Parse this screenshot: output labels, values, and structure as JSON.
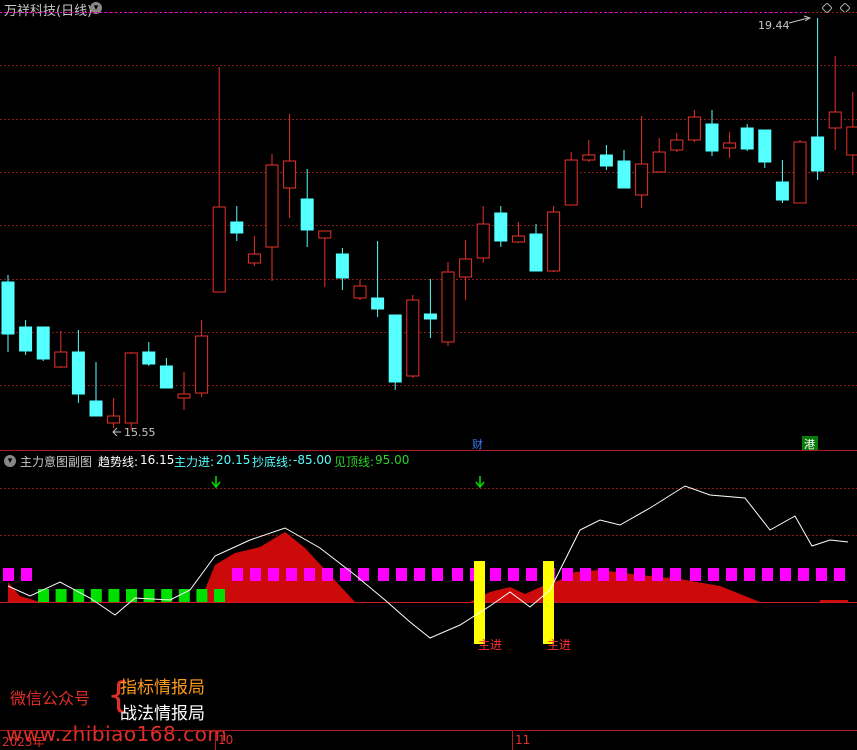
{
  "title": "万祥科技(日线)",
  "main_chart": {
    "high_label": "19.44",
    "low_label": "15.55",
    "markers": [
      {
        "label": "财",
        "color": "#3a7bff"
      },
      {
        "label": "港",
        "color": "#ffffff"
      }
    ],
    "colors": {
      "up": "#e8322a",
      "down": "#54ffff",
      "grid": "#8b1a1a"
    },
    "candles": [
      {
        "o": [
          282,
          334
        ],
        "l": [
          275,
          352
        ],
        "c": "#54ffff"
      },
      {
        "o": [
          327,
          351
        ],
        "l": [
          320,
          355
        ],
        "c": "#54ffff"
      },
      {
        "o": [
          327,
          359
        ],
        "l": [
          327,
          361
        ],
        "c": "#54ffff"
      },
      {
        "o": [
          352,
          367
        ],
        "l": [
          331,
          368
        ],
        "c": "#e8322a"
      },
      {
        "o": [
          352,
          394
        ],
        "l": [
          330,
          403
        ],
        "c": "#54ffff"
      },
      {
        "o": [
          401,
          416
        ],
        "l": [
          362,
          416
        ],
        "c": "#54ffff"
      },
      {
        "o": [
          416,
          423
        ],
        "l": [
          398,
          428
        ],
        "c": "#e8322a"
      },
      {
        "o": [
          353,
          423
        ],
        "l": [
          352,
          430
        ],
        "c": "#e8322a"
      },
      {
        "o": [
          352,
          364
        ],
        "l": [
          342,
          366
        ],
        "c": "#54ffff"
      },
      {
        "o": [
          366,
          388
        ],
        "l": [
          358,
          388
        ],
        "c": "#54ffff"
      },
      {
        "o": [
          394,
          398
        ],
        "l": [
          372,
          410
        ],
        "c": "#e8322a"
      },
      {
        "o": [
          336,
          393
        ],
        "l": [
          320,
          397
        ],
        "c": "#e8322a"
      },
      {
        "o": [
          207,
          292
        ],
        "l": [
          67,
          292
        ],
        "c": "#e8322a"
      },
      {
        "o": [
          222,
          233
        ],
        "l": [
          206,
          241
        ],
        "c": "#54ffff"
      },
      {
        "o": [
          254,
          263
        ],
        "l": [
          236,
          266
        ],
        "c": "#e8322a"
      },
      {
        "o": [
          165,
          247
        ],
        "l": [
          154,
          281
        ],
        "c": "#e8322a"
      },
      {
        "o": [
          161,
          188
        ],
        "l": [
          114,
          218
        ],
        "c": "#e8322a"
      },
      {
        "o": [
          199,
          230
        ],
        "l": [
          169,
          247
        ],
        "c": "#54ffff"
      },
      {
        "o": [
          231,
          238
        ],
        "l": [
          231,
          287
        ],
        "c": "#e8322a"
      },
      {
        "o": [
          254,
          278
        ],
        "l": [
          248,
          290
        ],
        "c": "#54ffff"
      },
      {
        "o": [
          286,
          298
        ],
        "l": [
          280,
          300
        ],
        "c": "#e8322a"
      },
      {
        "o": [
          298,
          309
        ],
        "l": [
          241,
          317
        ],
        "c": "#54ffff"
      },
      {
        "o": [
          315,
          382
        ],
        "l": [
          315,
          390
        ],
        "c": "#54ffff"
      },
      {
        "o": [
          300,
          376
        ],
        "l": [
          295,
          378
        ],
        "c": "#e8322a"
      },
      {
        "o": [
          314,
          319
        ],
        "l": [
          279,
          338
        ],
        "c": "#54ffff"
      },
      {
        "o": [
          272,
          342
        ],
        "l": [
          262,
          346
        ],
        "c": "#e8322a"
      },
      {
        "o": [
          259,
          277
        ],
        "l": [
          240,
          300
        ],
        "c": "#e8322a"
      },
      {
        "o": [
          224,
          258
        ],
        "l": [
          206,
          263
        ],
        "c": "#e8322a"
      },
      {
        "o": [
          213,
          241
        ],
        "l": [
          206,
          247
        ],
        "c": "#54ffff"
      },
      {
        "o": [
          236,
          242
        ],
        "l": [
          222,
          243
        ],
        "c": "#e8322a"
      },
      {
        "o": [
          234,
          271
        ],
        "l": [
          224,
          271
        ],
        "c": "#54ffff"
      },
      {
        "o": [
          212,
          271
        ],
        "l": [
          206,
          272
        ],
        "c": "#e8322a"
      },
      {
        "o": [
          160,
          205
        ],
        "l": [
          152,
          205
        ],
        "c": "#e8322a"
      },
      {
        "o": [
          155,
          160
        ],
        "l": [
          140,
          162
        ],
        "c": "#e8322a"
      },
      {
        "o": [
          155,
          166
        ],
        "l": [
          145,
          170
        ],
        "c": "#54ffff"
      },
      {
        "o": [
          161,
          188
        ],
        "l": [
          150,
          188
        ],
        "c": "#54ffff"
      },
      {
        "o": [
          164,
          195
        ],
        "l": [
          116,
          208
        ],
        "c": "#e8322a"
      },
      {
        "o": [
          152,
          172
        ],
        "l": [
          138,
          172
        ],
        "c": "#e8322a"
      },
      {
        "o": [
          140,
          150
        ],
        "l": [
          133,
          152
        ],
        "c": "#e8322a"
      },
      {
        "o": [
          117,
          140
        ],
        "l": [
          110,
          142
        ],
        "c": "#e8322a"
      },
      {
        "o": [
          124,
          151
        ],
        "l": [
          110,
          156
        ],
        "c": "#54ffff"
      },
      {
        "o": [
          143,
          148
        ],
        "l": [
          132,
          158
        ],
        "c": "#e8322a"
      },
      {
        "o": [
          128,
          149
        ],
        "l": [
          124,
          151
        ],
        "c": "#54ffff"
      },
      {
        "o": [
          130,
          162
        ],
        "l": [
          130,
          168
        ],
        "c": "#54ffff"
      },
      {
        "o": [
          182,
          200
        ],
        "l": [
          160,
          203
        ],
        "c": "#54ffff"
      },
      {
        "o": [
          142,
          203
        ],
        "l": [
          140,
          203
        ],
        "c": "#e8322a"
      },
      {
        "o": [
          137,
          171
        ],
        "l": [
          18,
          180
        ],
        "c": "#54ffff"
      },
      {
        "o": [
          112,
          128
        ],
        "l": [
          56,
          150
        ],
        "c": "#e8322a"
      },
      {
        "o": [
          127,
          155
        ],
        "l": [
          92,
          175
        ],
        "c": "#e8322a"
      }
    ]
  },
  "indicator": {
    "name": "主力意图副图",
    "trend": {
      "label": "趋势线:",
      "value": "16.15",
      "color": "#ffffff"
    },
    "main_force": {
      "label": "主力进:",
      "value": "20.15",
      "color": "#54ffff"
    },
    "bottom": {
      "label": "抄底线:",
      "value": "-85.00",
      "color": "#54ffff"
    },
    "top": {
      "label": "见顶线:",
      "value": "95.00",
      "color": "#2ad32a"
    },
    "signal_label": "主进",
    "colors": {
      "area": "#cc0a0a",
      "magenta": "#ff00ff",
      "green": "#00e000",
      "yellow": "#ffff00",
      "arrow": "#00e000",
      "line": "#ffffff"
    }
  },
  "watermark": {
    "left": "微信公众号",
    "line1": "指标情报局",
    "line2": "战法情报局",
    "url": "www.zhibiao168.com"
  },
  "x_axis": {
    "year": "2023年",
    "labels": [
      "10",
      "11"
    ]
  }
}
